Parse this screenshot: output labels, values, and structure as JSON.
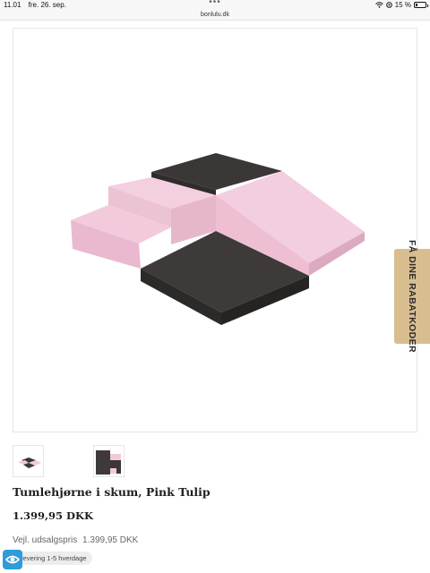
{
  "status_bar": {
    "time": "11.01",
    "date": "fre. 26. sep.",
    "battery_text": "15 %"
  },
  "browser": {
    "url": "bonlulu.dk"
  },
  "product": {
    "name": "Tumlehjørne i skum, Pink Tulip",
    "price": "1.399,95 DKK",
    "rrp_label": "Vejl. udsalgspris",
    "rrp_value": "1.399,95 DKK",
    "delivery": "levering 1-5 hverdage"
  },
  "promo_tab": {
    "label": "FÅ DINE RABATKODER"
  },
  "colors": {
    "pink": "#f2c9dc",
    "dark": "#3d3a39",
    "promo": "#d8bd8f",
    "a11y": "#2f9bd8"
  },
  "icons": [
    "wifi-icon",
    "location-icon",
    "battery-icon",
    "accessibility-eye-icon"
  ]
}
